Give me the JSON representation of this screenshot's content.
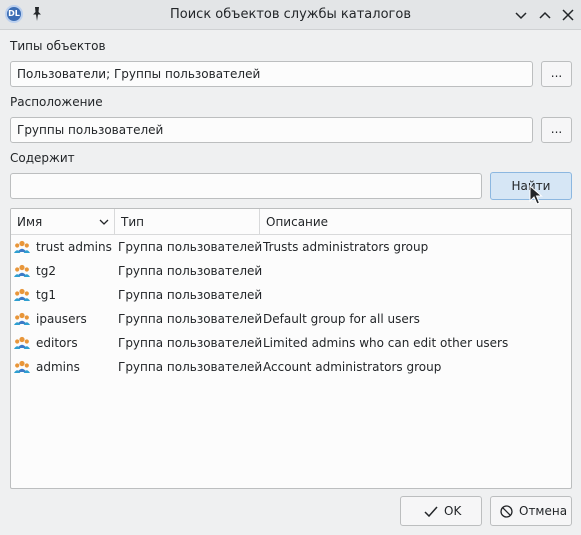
{
  "window": {
    "title": "Поиск объектов службы каталогов",
    "app_icon_text": "DL"
  },
  "object_types": {
    "label": "Типы объектов",
    "value": "Пользователи; Группы пользователей",
    "browse_label": "..."
  },
  "location": {
    "label": "Расположение",
    "value": "Группы пользователей",
    "browse_label": "..."
  },
  "contains": {
    "label": "Содержит",
    "value": "",
    "find_label": "Найти"
  },
  "results": {
    "columns": [
      "Имя",
      "Тип",
      "Описание"
    ],
    "rows": [
      {
        "name": "trust admins",
        "type": "Группа пользователей",
        "description": "Trusts administrators group"
      },
      {
        "name": "tg2",
        "type": "Группа пользователей",
        "description": ""
      },
      {
        "name": "tg1",
        "type": "Группа пользователей",
        "description": ""
      },
      {
        "name": "ipausers",
        "type": "Группа пользователей",
        "description": "Default group for all users"
      },
      {
        "name": "editors",
        "type": "Группа пользователей",
        "description": "Limited admins who can edit other users"
      },
      {
        "name": "admins",
        "type": "Группа пользователей",
        "description": "Account administrators group"
      }
    ]
  },
  "footer": {
    "ok_label": "OK",
    "cancel_label": "Отмена"
  },
  "colors": {
    "accent": "#3daee9",
    "window_bg": "#eff0f1",
    "button_primary": "#d6e6f5"
  }
}
